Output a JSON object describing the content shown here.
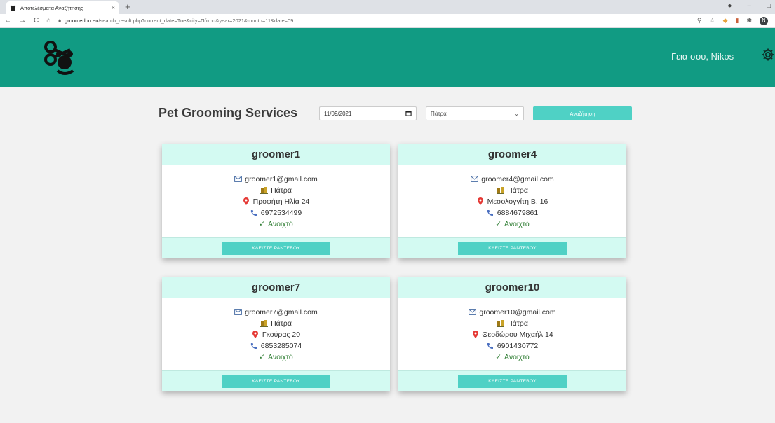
{
  "browser": {
    "tab_title": "Αποτελέσματα Αναζήτησης",
    "tab_close": "×",
    "new_tab": "+",
    "url_host": "groomedoo.eu",
    "url_path": "/search_result.php?current_date=Tue&city=Πάτρα&year=2021&month=11&date=09"
  },
  "header": {
    "greeting": "Γεια σου, Nikos",
    "brand_color": "#119b83"
  },
  "search": {
    "title": "Pet Grooming Services",
    "date_value": "11/09/2021",
    "city_value": "Πάτρα",
    "button_label": "Αναζήτηση"
  },
  "groomers": [
    {
      "name": "groomer1",
      "email": "groomer1@gmail.com",
      "city": "Πάτρα",
      "address": "Προφήτη Ηλία 24",
      "phone": "6972534499",
      "status": "Ανοιχτό",
      "book_label": "ΚΛΕΙΣΤΕ ΡΑΝΤΕΒΟΥ"
    },
    {
      "name": "groomer4",
      "email": "groomer4@gmail.com",
      "city": "Πάτρα",
      "address": "Μεσολογγίτη Β. 16",
      "phone": "6884679861",
      "status": "Ανοιχτό",
      "book_label": "ΚΛΕΙΣΤΕ ΡΑΝΤΕΒΟΥ"
    },
    {
      "name": "groomer7",
      "email": "groomer7@gmail.com",
      "city": "Πάτρα",
      "address": "Γκούρας 20",
      "phone": "6853285074",
      "status": "Ανοιχτό",
      "book_label": "ΚΛΕΙΣΤΕ ΡΑΝΤΕΒΟΥ"
    },
    {
      "name": "groomer10",
      "email": "groomer10@gmail.com",
      "city": "Πάτρα",
      "address": "Θεοδώρου Μιχαήλ 14",
      "phone": "6901430772",
      "status": "Ανοιχτό",
      "book_label": "ΚΛΕΙΣΤΕ ΡΑΝΤΕΒΟΥ"
    }
  ]
}
